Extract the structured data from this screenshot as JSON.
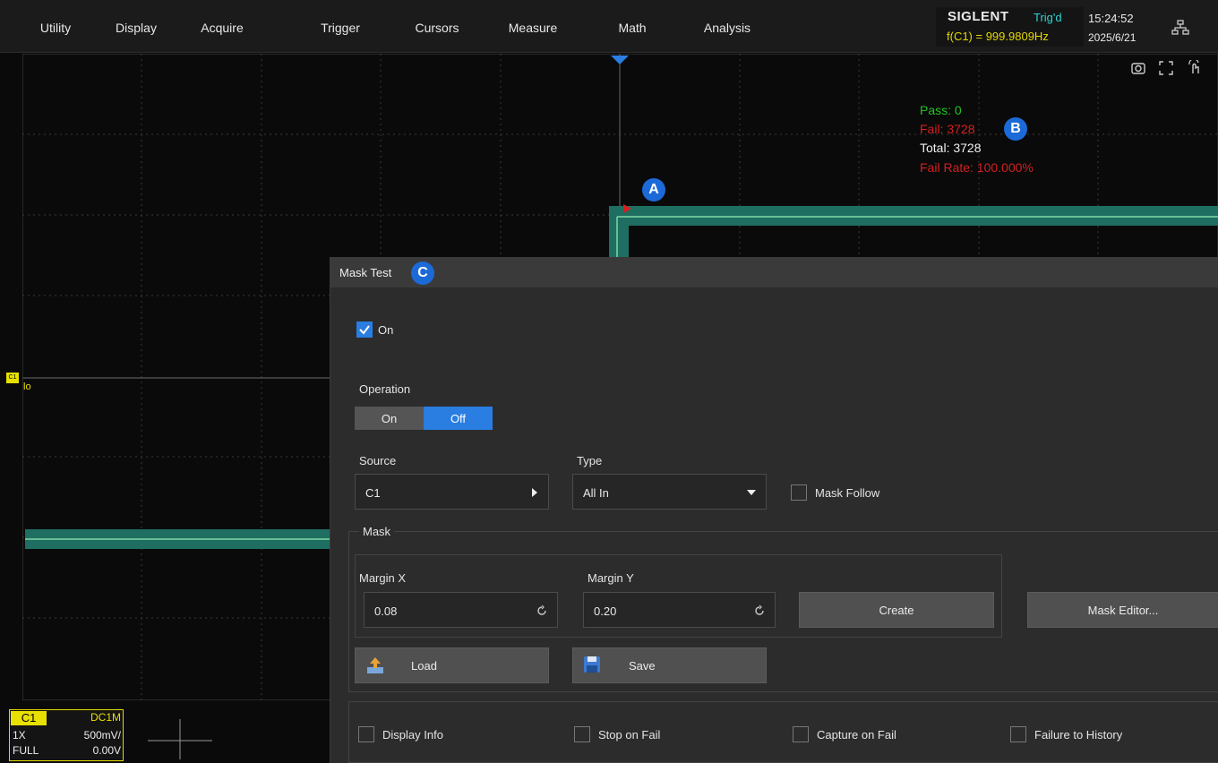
{
  "menu": {
    "utility": "Utility",
    "display": "Display",
    "acquire": "Acquire",
    "trigger": "Trigger",
    "cursors": "Cursors",
    "measure": "Measure",
    "math": "Math",
    "analysis": "Analysis"
  },
  "status": {
    "brand": "SIGLENT",
    "trigger_state": "Trig'd",
    "frequency": "f(C1) = 999.9809Hz",
    "time": "15:24:52",
    "date": "2025/6/21"
  },
  "mask_stats": {
    "pass": "Pass: 0",
    "fail": "Fail: 3728",
    "total": "Total: 3728",
    "fail_rate": "Fail Rate: 100.000%"
  },
  "callouts": {
    "a": "A",
    "b": "B",
    "c": "C"
  },
  "channel_marker": {
    "tag": "C1",
    "level_label": "lo"
  },
  "channel_info": {
    "name": "C1",
    "coupling": "DC1M",
    "probe": "1X",
    "scale": "500mV/",
    "bandwidth": "FULL",
    "offset": "0.00V"
  },
  "dialog": {
    "title": "Mask Test",
    "enable_label": "On",
    "enable_checked": true,
    "operation_label": "Operation",
    "operation_on": "On",
    "operation_off": "Off",
    "operation_selected": "Off",
    "source_label": "Source",
    "source_value": "C1",
    "type_label": "Type",
    "type_value": "All In",
    "mask_follow_label": "Mask Follow",
    "mask_group_label": "Mask",
    "margin_x_label": "Margin X",
    "margin_x_value": "0.08",
    "margin_y_label": "Margin Y",
    "margin_y_value": "0.20",
    "create_label": "Create",
    "mask_editor_label": "Mask Editor...",
    "load_label": "Load",
    "save_label": "Save",
    "display_info_label": "Display Info",
    "stop_on_fail_label": "Stop on Fail",
    "capture_on_fail_label": "Capture on Fail",
    "failure_to_history_label": "Failure to History"
  },
  "colors": {
    "accent": "#2a7de1",
    "pass": "#22c322",
    "fail": "#d42020",
    "channel": "#e8e000",
    "trace": "#1f6e62"
  },
  "icons": [
    "network-icon",
    "screenshot-icon",
    "fullscreen-icon",
    "touch-icon",
    "load-icon",
    "save-icon"
  ]
}
